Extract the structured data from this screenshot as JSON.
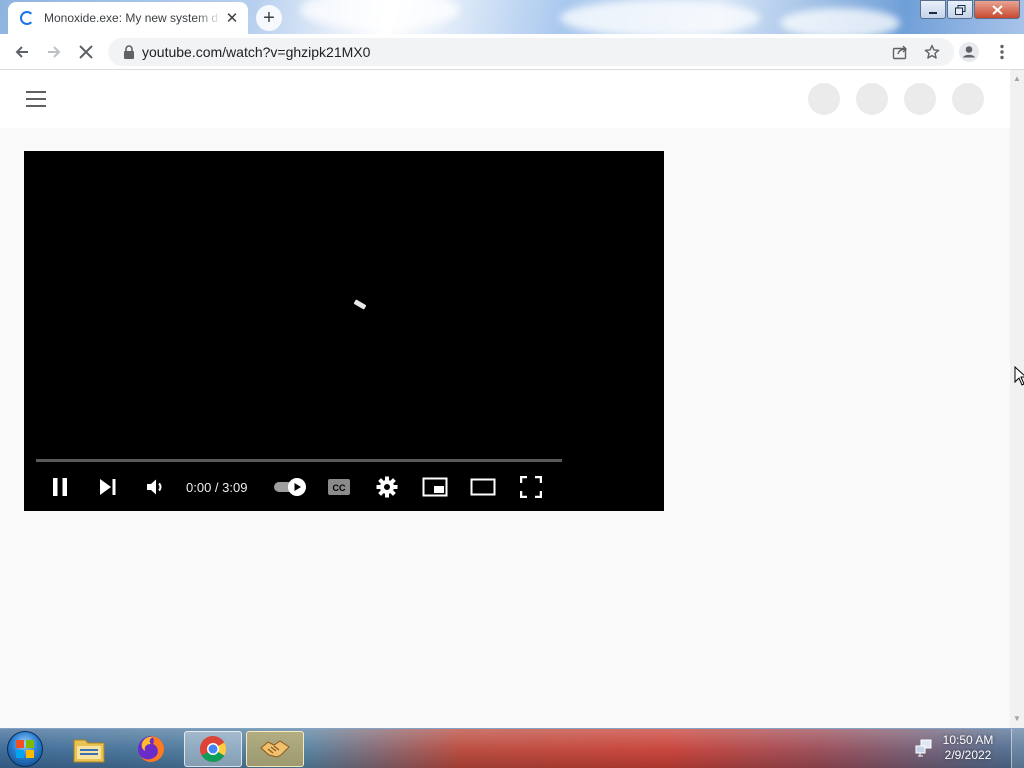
{
  "browser": {
    "tab": {
      "title": "Monoxide.exe: My new system d",
      "close_icon": "close-icon",
      "loading_icon": "spinner-icon"
    },
    "new_tab_icon": "plus-icon",
    "window_controls": [
      "minimize-icon",
      "restore-icon",
      "close-icon"
    ],
    "toolbar": {
      "back_icon": "arrow-left-icon",
      "forward_icon": "arrow-right-icon",
      "stop_icon": "stop-loading-icon",
      "url": "youtube.com/watch?v=ghzipk21MX0",
      "icons": [
        "lock-icon",
        "share-icon",
        "star-icon",
        "profile-icon",
        "kebab-menu-icon"
      ]
    }
  },
  "youtube": {
    "header_icons": [
      "menu-icon"
    ],
    "player": {
      "time_display": "0:00 / 3:09",
      "progress": 0.0,
      "controls": [
        "pause-icon",
        "next-icon",
        "volume-icon",
        "autoplay-toggle",
        "captions-icon",
        "settings-gear-icon",
        "miniplayer-icon",
        "theater-mode-icon",
        "fullscreen-icon"
      ],
      "captions_label": "CC"
    }
  },
  "taskbar": {
    "pinned": [
      "windows-start-icon",
      "file-explorer-icon",
      "firefox-icon",
      "chrome-icon",
      "handshake-icon"
    ],
    "clock": {
      "time": "10:50 AM",
      "date": "2/9/2022"
    }
  },
  "colors": {
    "chrome_blue": "#1a73e8",
    "player_bg": "#000000",
    "page_bg": "#f9f9f9"
  }
}
